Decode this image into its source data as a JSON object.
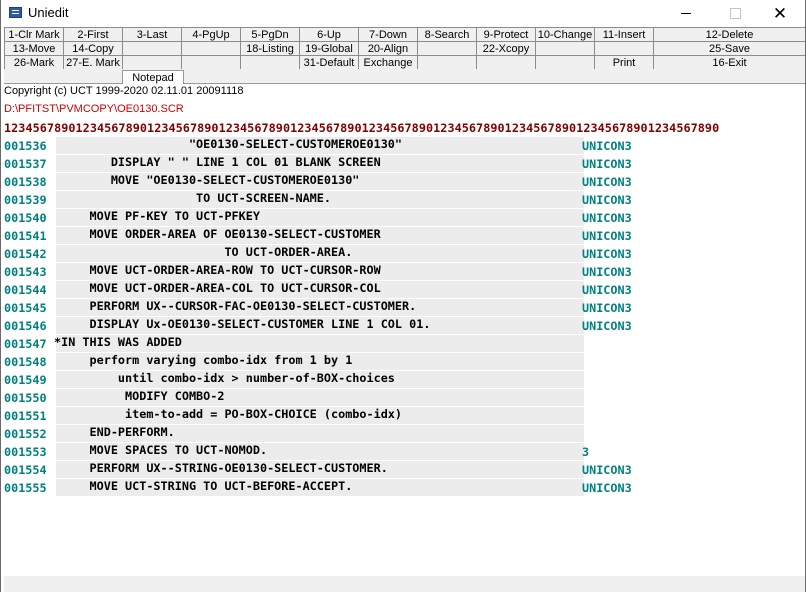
{
  "window": {
    "title": "Uniedit",
    "minimize_glyph": "",
    "maximize_glyph": "",
    "close_glyph": "✕"
  },
  "fkeys": {
    "row1": [
      "1-Clr Mark",
      "2-First",
      "3-Last",
      "4-PgUp",
      "5-PgDn",
      "6-Up",
      "7-Down",
      "8-Search",
      "9-Protect",
      "10-Change",
      "11-Insert",
      "12-Delete"
    ],
    "row2": [
      "13-Move",
      "14-Copy",
      "",
      "",
      "18-Listing",
      "19-Global",
      "20-Align",
      "",
      "22-Xcopy",
      "",
      "",
      "25-Save"
    ],
    "row3": [
      "26-Mark",
      "27-E. Mark",
      "",
      "",
      "",
      "31-Default",
      "Exchange",
      "",
      "",
      "",
      "Print",
      "16-Exit"
    ]
  },
  "tabs": [
    "Notepad"
  ],
  "copyright": "Copyright (c) UCT 1999-2020 02.11.01 20091118",
  "file_path": "D:\\PFITST\\PVMCOPY\\OE0130.SCR",
  "ruler": "1234567890123456789012345678901234567890123456789012345678901234567890123456789012345678901234567890",
  "lines": [
    {
      "num": "001536",
      "code": "                   \"OE0130-SELECT-CUSTOMEROE0130\"",
      "tag": "UNICON3"
    },
    {
      "num": "001537",
      "code": "        DISPLAY \" \" LINE 1 COL 01 BLANK SCREEN",
      "tag": "UNICON3"
    },
    {
      "num": "001538",
      "code": "        MOVE \"OE0130-SELECT-CUSTOMEROE0130\"",
      "tag": "UNICON3"
    },
    {
      "num": "001539",
      "code": "                    TO UCT-SCREEN-NAME.",
      "tag": "UNICON3"
    },
    {
      "num": "001540",
      "code": "     MOVE PF-KEY TO UCT-PFKEY",
      "tag": "UNICON3"
    },
    {
      "num": "001541",
      "code": "     MOVE ORDER-AREA OF OE0130-SELECT-CUSTOMER",
      "tag": "UNICON3"
    },
    {
      "num": "001542",
      "code": "                        TO UCT-ORDER-AREA.",
      "tag": "UNICON3"
    },
    {
      "num": "001543",
      "code": "     MOVE UCT-ORDER-AREA-ROW TO UCT-CURSOR-ROW",
      "tag": "UNICON3"
    },
    {
      "num": "001544",
      "code": "     MOVE UCT-ORDER-AREA-COL TO UCT-CURSOR-COL",
      "tag": "UNICON3"
    },
    {
      "num": "001545",
      "code": "     PERFORM UX--CURSOR-FAC-OE0130-SELECT-CUSTOMER.",
      "tag": "UNICON3"
    },
    {
      "num": "001546",
      "code": "     DISPLAY Ux-OE0130-SELECT-CUSTOMER LINE 1 COL 01.",
      "tag": "UNICON3"
    },
    {
      "num": "001547",
      "code": "*IN THIS WAS ADDED",
      "tag": ""
    },
    {
      "num": "001548",
      "code": "     perform varying combo-idx from 1 by 1",
      "tag": ""
    },
    {
      "num": "001549",
      "code": "         until combo-idx > number-of-BOX-choices",
      "tag": ""
    },
    {
      "num": "001550",
      "code": "          MODIFY COMBO-2",
      "tag": ""
    },
    {
      "num": "001551",
      "code": "          item-to-add = PO-BOX-CHOICE (combo-idx)",
      "tag": ""
    },
    {
      "num": "001552",
      "code": "     END-PERFORM.",
      "tag": ""
    },
    {
      "num": "001553",
      "code": "     MOVE SPACES TO UCT-NOMOD.",
      "tag": "3"
    },
    {
      "num": "001554",
      "code": "     PERFORM UX--STRING-OE0130-SELECT-CUSTOMER.",
      "tag": "UNICON3"
    },
    {
      "num": "001555",
      "code": "     MOVE UCT-STRING TO UCT-BEFORE-ACCEPT.",
      "tag": "UNICON3"
    }
  ],
  "colors": {
    "line_number": "#008080",
    "path": "#cc0000",
    "ruler": "#800000",
    "code_background": "#ececec"
  }
}
